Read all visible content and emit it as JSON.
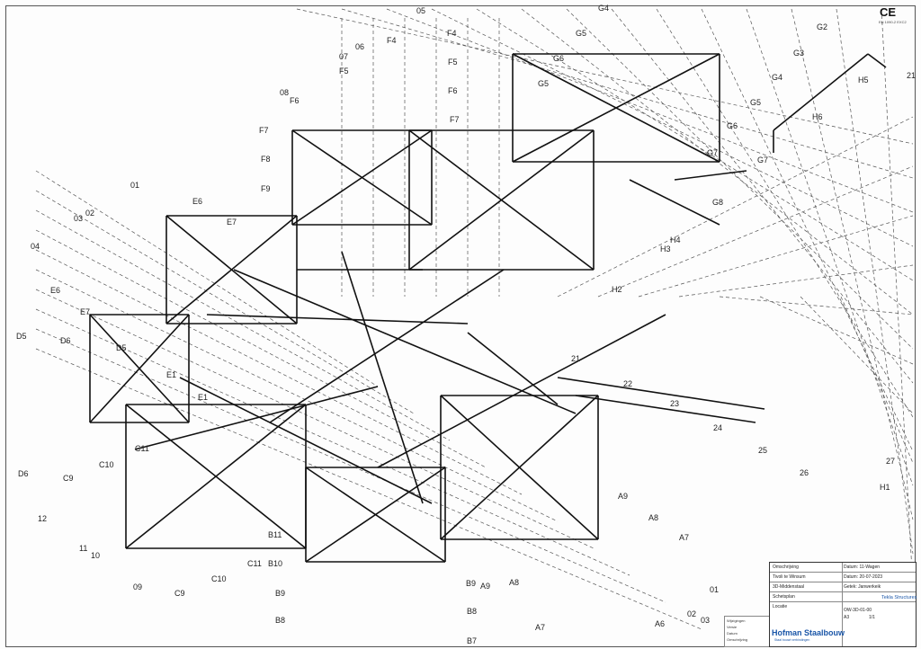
{
  "ce_mark": "CE",
  "ce_sub": "EN 1090-2 EXC2",
  "grid_labels": {
    "top": [
      "05",
      "06",
      "07",
      "08",
      "F4",
      "F4",
      "F5",
      "F5",
      "F6",
      "F6",
      "F7",
      "F7",
      "F8",
      "F9",
      "G4",
      "G2",
      "G3",
      "G4",
      "G5",
      "G5",
      "G6",
      "G5",
      "G6",
      "G7",
      "G7",
      "G8",
      "H4",
      "H3",
      "H2",
      "21",
      "H6",
      "H5"
    ],
    "left": [
      "01",
      "02",
      "03",
      "04",
      "E6",
      "E6",
      "E7",
      "E7",
      "D5",
      "D6",
      "D6",
      "D5",
      "E1",
      "E1"
    ],
    "bottom": [
      "12",
      "11",
      "10",
      "09",
      "C9",
      "C10",
      "C11",
      "C11",
      "C10",
      "C9",
      "B11",
      "B10",
      "B9",
      "B9",
      "B8",
      "B8",
      "B7",
      "A9",
      "A9",
      "A8",
      "A8",
      "A7",
      "A7",
      "A6",
      "01",
      "02",
      "03",
      "H1",
      "26",
      "27",
      "25",
      "24",
      "23",
      "22",
      "21"
    ]
  },
  "title_block": {
    "project_label": "Omschrijving",
    "rows": [
      "Omschrijving",
      "Tivoli te Winsum",
      "3D-Middenstaal",
      "Schetsplan",
      "Locatie"
    ],
    "right": [
      "Datum: 11-Wagen",
      "Datum: 20-07-2023",
      "Getek: Janwerkeik"
    ],
    "drawing_no_label": "Tek nr.",
    "drawing_no": "OW-3D-01-00",
    "scale_label": "Formaat",
    "scale": "A3",
    "sheet_label": "Blad",
    "sheet": "1/1"
  },
  "tekla": "Tekla Structures",
  "logo": {
    "name": "Hofman Staalbouw",
    "sub": "Staal bouwt verbindingen"
  },
  "legend": [
    "Wijzigingen",
    "Versie",
    "Datum",
    "Omschrijving"
  ]
}
